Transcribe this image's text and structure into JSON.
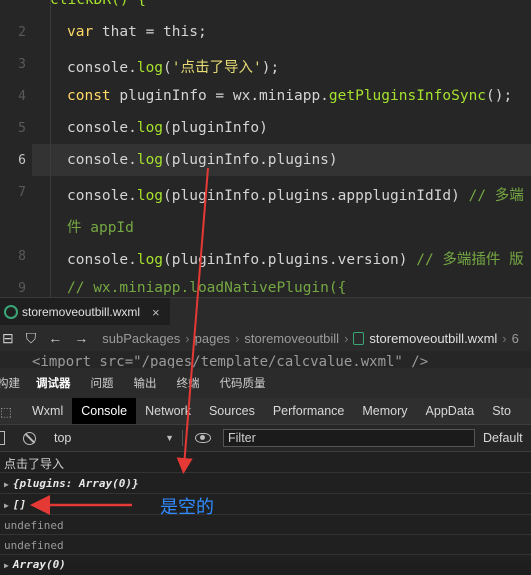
{
  "editor": {
    "line_numbers": [
      "",
      "2",
      "3",
      "4",
      "5",
      "6",
      "7",
      "",
      "8",
      "9"
    ],
    "partial_header": "clickDR() {",
    "lines": {
      "l1": {
        "kw": "var",
        "rest": " that = this;"
      },
      "l2": {
        "a": "console.",
        "fn": "log",
        "b": "(",
        "str": "'点击了导入'",
        "c": ");"
      },
      "l3": {
        "kw": "const",
        "a": " pluginInfo = wx.miniapp.",
        "fn": "getPluginsInfoSync",
        "b": "();"
      },
      "l4": {
        "a": "console.",
        "fn": "log",
        "b": "(pluginInfo)"
      },
      "l5": {
        "a": "console.",
        "fn": "log",
        "b": "(pluginInfo.plugins)"
      },
      "l6": {
        "a": "console.",
        "fn": "log",
        "b": "(pluginInfo.plugins.apppluginIdId) ",
        "cmt": "// 多端"
      },
      "l6b": {
        "cmt": "件 appId"
      },
      "l7": {
        "a": "console.",
        "fn": "log",
        "b": "(pluginInfo.plugins.version) ",
        "cmt": "// 多端插件 版"
      },
      "l8": {
        "cmt": "// wx.miniapp.loadNativePlugin({"
      }
    }
  },
  "file_tab": {
    "name": "storemoveoutbill.wxml",
    "close": "×"
  },
  "breadcrumb": {
    "items": [
      "subPackages",
      "pages",
      "storemoveoutbill",
      "storemoveoutbill.wxml",
      "6"
    ]
  },
  "import_line": "<import src=\"/pages/template/calcvalue.wxml\" />",
  "panel_tabs": [
    "构建",
    "调试器",
    "问题",
    "输出",
    "终端",
    "代码质量"
  ],
  "panel_active": "调试器",
  "devtools_tabs": [
    "Wxml",
    "Console",
    "Network",
    "Sources",
    "Performance",
    "Memory",
    "AppData",
    "Sto"
  ],
  "devtools_active": "Console",
  "console_toolbar": {
    "context": "top",
    "filter_placeholder": "Filter",
    "levels": "Default"
  },
  "console_rows": [
    {
      "text": "点击了导入"
    },
    {
      "text": "{plugins: Array(0)}"
    },
    {
      "text": "[]"
    },
    {
      "text": "undefined"
    },
    {
      "text": "undefined"
    },
    {
      "text": "Array(0)"
    }
  ],
  "annotation": {
    "note": "是空的",
    "color": "#e53935"
  }
}
